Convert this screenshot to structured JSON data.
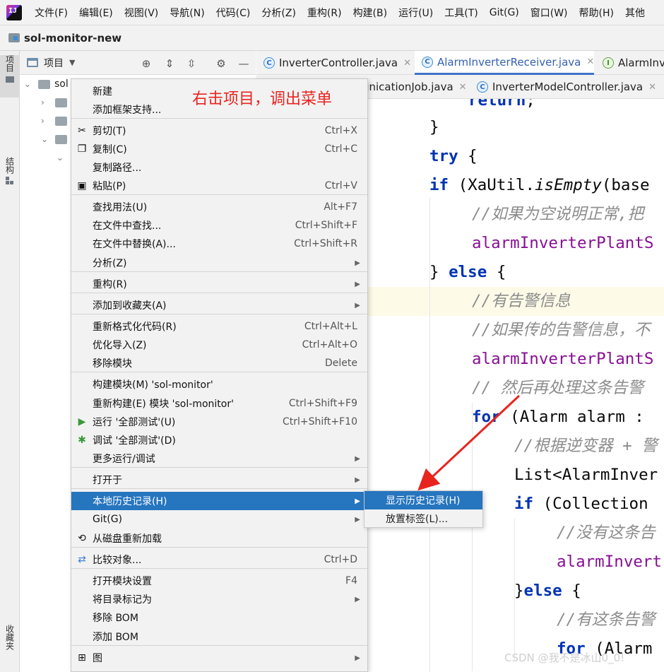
{
  "menubar": {
    "items": [
      "文件(F)",
      "编辑(E)",
      "视图(V)",
      "导航(N)",
      "代码(C)",
      "分析(Z)",
      "重构(R)",
      "构建(B)",
      "运行(U)",
      "工具(T)",
      "Git(G)",
      "窗口(W)",
      "帮助(H)",
      "其他"
    ]
  },
  "title": {
    "project": "sol-monitor-new"
  },
  "left_strip": {
    "project": "项目",
    "structure": "结构",
    "favorites": "收藏夹"
  },
  "project_panel": {
    "view_label": "项目",
    "tree": [
      {
        "label": "sol",
        "chevron": "⌄"
      },
      {
        "label": "",
        "chevron": "›"
      },
      {
        "label": "",
        "chevron": "›"
      },
      {
        "label": "",
        "chevron": "⌄"
      },
      {
        "label": "",
        "chevron": "⌄"
      }
    ]
  },
  "tabs": {
    "row1": [
      {
        "name": "InverterController.java",
        "icon": "C",
        "active": false
      },
      {
        "name": "AlarmInverterReceiver.java",
        "icon": "C",
        "active": true
      },
      {
        "name": "AlarmInve",
        "icon": "I",
        "active": false
      }
    ],
    "row2": [
      {
        "name": "unicationJob.java",
        "icon": "",
        "active": false
      },
      {
        "name": "InverterModelController.java",
        "icon": "C",
        "active": false
      }
    ]
  },
  "code": {
    "lines": [
      "return;",
      "}",
      "try {",
      "if (XaUtil.isEmpty(base",
      "//如果为空说明正常,把",
      "alarmInverterPlantS",
      "} else {",
      "//有告警信息",
      "//如果传的告警信息，不",
      "alarmInverterPlantS",
      "// 然后再处理这条告警",
      "for (Alarm alarm :",
      "//根据逆变器 + 警",
      "List<AlarmInver",
      "if (Collection",
      "//没有这条告",
      "alarmInvert",
      "}else {",
      "//有这条告警",
      "for (Alarm"
    ]
  },
  "context_menu": {
    "items": [
      {
        "label": "新建",
        "shortcut": "",
        "arrow": false
      },
      {
        "label": "添加框架支持...",
        "shortcut": "",
        "arrow": false
      },
      {
        "label": "剪切(T)",
        "shortcut": "Ctrl+X",
        "arrow": false,
        "icon": "scissors-icon"
      },
      {
        "label": "复制(C)",
        "shortcut": "Ctrl+C",
        "arrow": false,
        "icon": "copy-icon"
      },
      {
        "label": "复制路径...",
        "shortcut": "",
        "arrow": false
      },
      {
        "label": "粘贴(P)",
        "shortcut": "Ctrl+V",
        "arrow": false,
        "icon": "paste-icon"
      },
      {
        "label": "查找用法(U)",
        "shortcut": "Alt+F7",
        "arrow": false
      },
      {
        "label": "在文件中查找...",
        "shortcut": "Ctrl+Shift+F",
        "arrow": false
      },
      {
        "label": "在文件中替换(A)...",
        "shortcut": "Ctrl+Shift+R",
        "arrow": false
      },
      {
        "label": "分析(Z)",
        "shortcut": "",
        "arrow": true
      },
      {
        "label": "重构(R)",
        "shortcut": "",
        "arrow": true
      },
      {
        "label": "添加到收藏夹(A)",
        "shortcut": "",
        "arrow": true
      },
      {
        "label": "重新格式化代码(R)",
        "shortcut": "Ctrl+Alt+L",
        "arrow": false
      },
      {
        "label": "优化导入(Z)",
        "shortcut": "Ctrl+Alt+O",
        "arrow": false
      },
      {
        "label": "移除模块",
        "shortcut": "Delete",
        "arrow": false
      },
      {
        "label": "构建模块(M) 'sol-monitor'",
        "shortcut": "",
        "arrow": false
      },
      {
        "label": "重新构建(E) 模块 'sol-monitor'",
        "shortcut": "Ctrl+Shift+F9",
        "arrow": false
      },
      {
        "label": "运行 '全部测试'(U)",
        "shortcut": "Ctrl+Shift+F10",
        "arrow": false,
        "icon": "run-icon"
      },
      {
        "label": "调试 '全部测试'(D)",
        "shortcut": "",
        "arrow": false,
        "icon": "debug-icon"
      },
      {
        "label": "更多运行/调试",
        "shortcut": "",
        "arrow": true
      },
      {
        "label": "打开于",
        "shortcut": "",
        "arrow": true
      },
      {
        "label": "本地历史记录(H)",
        "shortcut": "",
        "arrow": true,
        "selected": true
      },
      {
        "label": "Git(G)",
        "shortcut": "",
        "arrow": true
      },
      {
        "label": "从磁盘重新加载",
        "shortcut": "",
        "arrow": false,
        "icon": "reload-icon"
      },
      {
        "label": "比较对象...",
        "shortcut": "Ctrl+D",
        "arrow": false,
        "icon": "compare-icon"
      },
      {
        "label": "打开模块设置",
        "shortcut": "F4",
        "arrow": false
      },
      {
        "label": "将目录标记为",
        "shortcut": "",
        "arrow": true
      },
      {
        "label": "移除 BOM",
        "shortcut": "",
        "arrow": false
      },
      {
        "label": "添加 BOM",
        "shortcut": "",
        "arrow": false
      },
      {
        "label": "图",
        "shortcut": "",
        "arrow": true,
        "icon": "diagram-icon"
      }
    ]
  },
  "submenu": {
    "items": [
      "显示历史记录(H)",
      "放置标签(L)..."
    ]
  },
  "annotation": {
    "text": "右击项目，调出菜单"
  },
  "watermark": {
    "text": "CSDN @我不是冰山0_0!"
  },
  "colors": {
    "selection": "#2675bf",
    "annotation": "#e8241f",
    "keyword": "#0033b3",
    "comment": "#8c8c8c",
    "field": "#871094"
  }
}
